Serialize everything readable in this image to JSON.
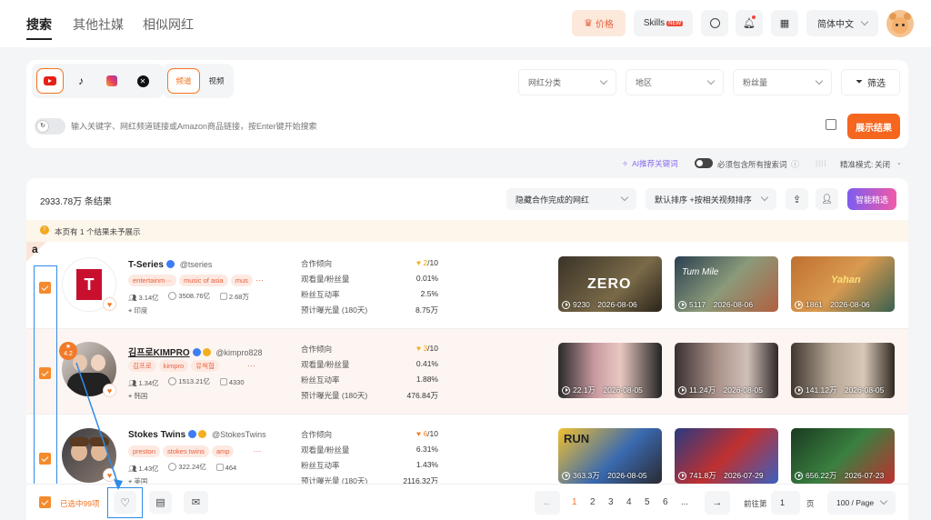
{
  "nav": {
    "tabs": [
      "搜索",
      "其他社媒",
      "相似网红"
    ],
    "price_label": "价格",
    "skills_label": "Skills",
    "skills_badge": "NEW",
    "language": "简体中文"
  },
  "search": {
    "platforms": [
      "youtube-icon",
      "tiktok-icon",
      "instagram-icon",
      "x-icon"
    ],
    "content_types": [
      "频道",
      "视频"
    ],
    "filters": [
      "网红分类",
      "地区",
      "粉丝量"
    ],
    "filter_button": "筛选",
    "placeholder": "输入关键字、网红频道链接或Amazon商品链接，按Enter键开始搜索",
    "submit_label": "展示结果",
    "ai_keywords_label": "AI推荐关键词",
    "must_include_label": "必须包含所有搜索词",
    "precise_mode_label": "精准模式:",
    "precise_mode_value": "关闭"
  },
  "results": {
    "count_label": "2933.78万 条结果",
    "hide_completed": "隐藏合作完成的网红",
    "sort_label": "默认排序 +按相关视频排序",
    "smart_select_label": "智能精选",
    "notice": "本页有 1 个结果未予展示",
    "annotation_letter": "a"
  },
  "metric_labels": [
    "合作倾向",
    "观看量/粉丝量",
    "粉丝互动率",
    "预计曝光量 (180天)"
  ],
  "influencers": [
    {
      "name": "T-Series",
      "handle": "@tseries",
      "tags": [
        "entertainm···",
        "music of asia",
        "mus"
      ],
      "subscribers": "3.14亿",
      "views": "3508.76亿",
      "videos": "2.68万",
      "region": "印度",
      "coop_score": "2",
      "coop_max": "/10",
      "view_ratio": "0.01%",
      "engagement": "2.5%",
      "exposure": "8.75万",
      "videos_list": [
        {
          "count": "9230",
          "date": "2026-08-06",
          "overlay": "ZERO"
        },
        {
          "count": "5117",
          "date": "2026-08-06",
          "overlay": "Tum Mile"
        },
        {
          "count": "1861",
          "date": "2026-08-06",
          "overlay": "Yahan"
        }
      ]
    },
    {
      "name": "김프로KIMPRO",
      "handle": "@kimpro828",
      "tags": [
        "김프로",
        "kimpro",
        "유씩협"
      ],
      "subscribers": "1.34亿",
      "views": "1513.21亿",
      "videos": "4330",
      "region": "韩国",
      "rating": "4.2",
      "coop_score": "3",
      "coop_max": "/10",
      "view_ratio": "0.41%",
      "engagement": "1.88%",
      "exposure": "476.84万",
      "videos_list": [
        {
          "count": "22.1万",
          "date": "2026-08-05",
          "overlay": ""
        },
        {
          "count": "11.24万",
          "date": "2026-08-05",
          "overlay": ""
        },
        {
          "count": "141.12万",
          "date": "2026-08-05",
          "overlay": ""
        }
      ]
    },
    {
      "name": "Stokes Twins",
      "handle": "@StokesTwins",
      "tags": [
        "preston",
        "stokes twins",
        "amp"
      ],
      "subscribers": "1.43亿",
      "views": "322.24亿",
      "videos": "464",
      "region": "美国",
      "coop_score": "6",
      "coop_max": "/10",
      "view_ratio": "6.31%",
      "engagement": "1.43%",
      "exposure": "2116.32万",
      "videos_list": [
        {
          "count": "363.3万",
          "date": "2026-08-05",
          "overlay": "RUN"
        },
        {
          "count": "741.8万",
          "date": "2026-07-29",
          "overlay": ""
        },
        {
          "count": "656.22万",
          "date": "2026-07-23",
          "overlay": ""
        }
      ]
    }
  ],
  "footer": {
    "selected_label": "已选中99项",
    "pages": [
      "1",
      "2",
      "3",
      "4",
      "5",
      "6",
      "..."
    ],
    "goto_label": "前往第",
    "goto_value": "1",
    "page_unit": "页",
    "per_page": "100 / Page"
  },
  "colors": {
    "accent": "#f5731f",
    "tag_bg": "#fde9e2",
    "annotation": "#2f8be8"
  }
}
